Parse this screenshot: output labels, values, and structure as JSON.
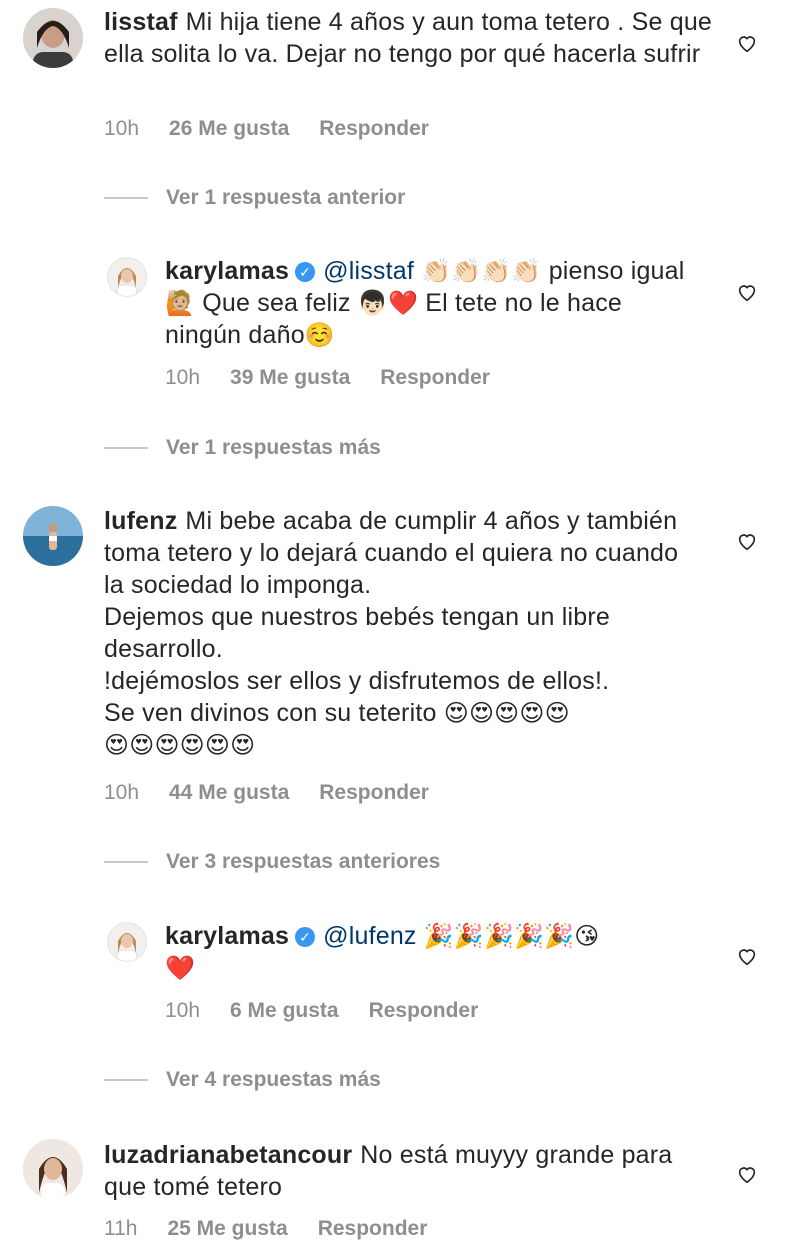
{
  "comments": [
    {
      "username": "lisstaf",
      "text": "Mi hija tiene 4 años y aun toma tetero . Se que ella solita lo va. Dejar no tengo por qué hacerla sufrir",
      "time": "10h",
      "likes": "26 Me gusta",
      "reply": "Responder"
    },
    {
      "username": "karylamas",
      "mention": "@lisstaf",
      "emoji1": "👏🏻👏🏻👏🏻👏🏻",
      "text1": "pienso igual",
      "emoji2": "🙋🏼",
      "text2": "Que sea feliz",
      "emoji3": "👦🏻❤️",
      "text3": "El tete no le hace ningún daño",
      "emoji4": "☺️",
      "time": "10h",
      "likes": "39 Me gusta",
      "reply": "Responder"
    },
    {
      "username": "lufenz",
      "text": "Mi bebe acaba de cumplir 4 años y también toma tetero y lo dejará cuando el quiera no cuando la sociedad lo imponga.",
      "text2": "Dejemos que nuestros bebés tengan un libre desarrollo.",
      "text3": " !dejémoslos ser ellos y disfrutemos de ellos!.",
      "text4": "Se ven divinos con su teterito",
      "emoji": "😍😍😍😍😍",
      "emoji2": "😍😍😍😍😍😍",
      "time": "10h",
      "likes": "44 Me gusta",
      "reply": "Responder"
    },
    {
      "username": "karylamas",
      "mention": "@lufenz",
      "emoji": "🎉🎉🎉🎉🎉😘",
      "emoji2": "❤️",
      "time": "10h",
      "likes": "6 Me gusta",
      "reply": "Responder"
    },
    {
      "username": "luzadrianabetancour",
      "text": "No está muyyy grande para que tomé tetero",
      "time": "11h",
      "likes": "25 Me gusta",
      "reply": "Responder"
    }
  ],
  "toggles": {
    "t1": "Ver 1 respuesta anterior",
    "t2": "Ver 1 respuestas más",
    "t3": "Ver 3 respuestas anteriores",
    "t4": "Ver 4 respuestas más"
  },
  "colors": {
    "verified": "#3897f0",
    "mention": "#00376b",
    "meta": "#8e8e8e"
  }
}
